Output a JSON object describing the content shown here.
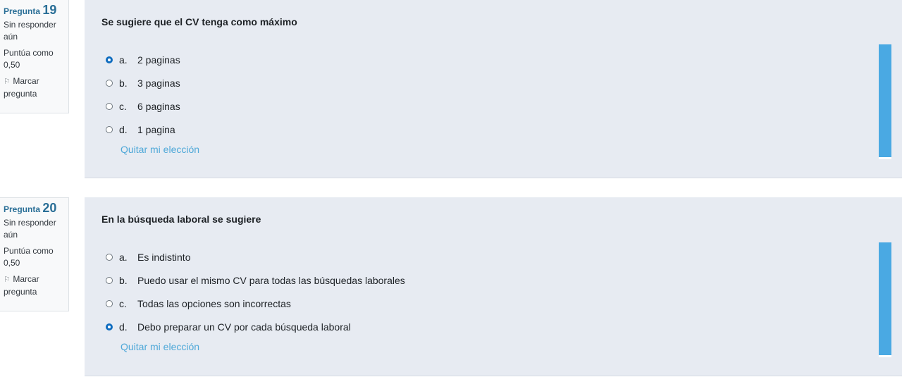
{
  "questions": [
    {
      "label": "Pregunta",
      "number": "19",
      "state": "Sin responder aún",
      "grade": "Puntúa como 0,50",
      "flag_label": "Marcar pregunta",
      "text": "Se sugiere que el CV tenga como máximo",
      "answers": [
        {
          "letter": "a.",
          "text": "2 paginas",
          "checked": true
        },
        {
          "letter": "b.",
          "text": "3 paginas",
          "checked": false
        },
        {
          "letter": "c.",
          "text": "6 paginas",
          "checked": false
        },
        {
          "letter": "d.",
          "text": "1 pagina",
          "checked": false
        }
      ],
      "clear_label": "Quitar mi elección"
    },
    {
      "label": "Pregunta",
      "number": "20",
      "state": "Sin responder aún",
      "grade": "Puntúa como 0,50",
      "flag_label": "Marcar pregunta",
      "text": "En la búsqueda laboral se sugiere",
      "answers": [
        {
          "letter": "a.",
          "text": "Es indistinto",
          "checked": false
        },
        {
          "letter": "b.",
          "text": "Puedo usar el mismo CV para todas las búsquedas laborales",
          "checked": false
        },
        {
          "letter": "c.",
          "text": "Todas las opciones son incorrectas",
          "checked": false
        },
        {
          "letter": "d.",
          "text": "Debo preparar un CV por cada búsqueda laboral",
          "checked": true
        }
      ],
      "clear_label": "Quitar mi elección"
    }
  ],
  "icons": {
    "flag": "flag-icon"
  },
  "colors": {
    "accent": "#0f6cbf",
    "qno": "#2a6f97",
    "panel": "#e7ebf2",
    "scroll": "#4aa9e3",
    "link": "#4fa8d8"
  }
}
